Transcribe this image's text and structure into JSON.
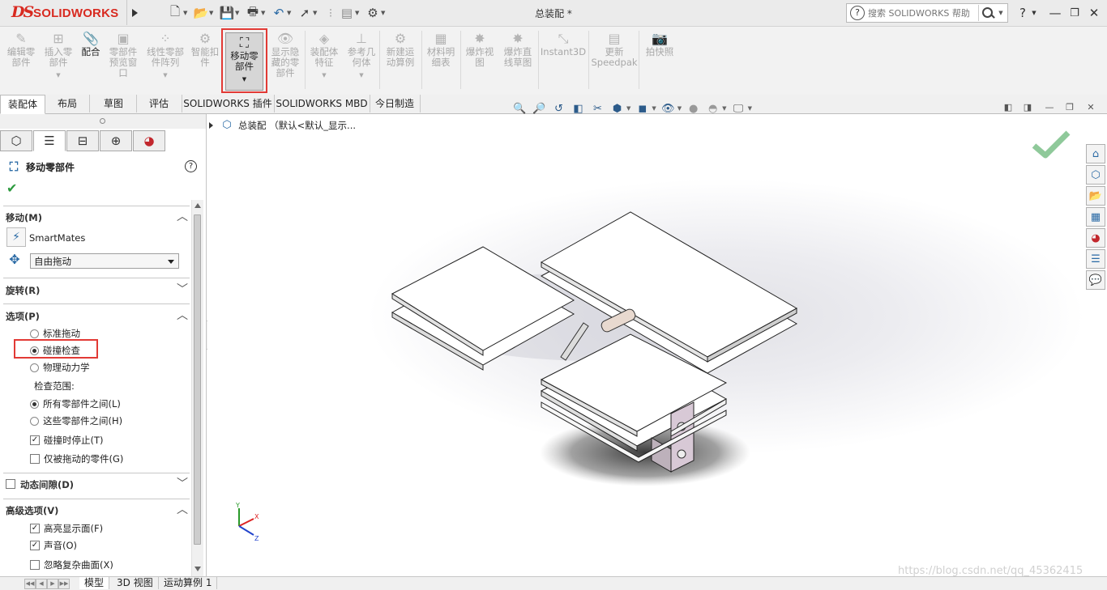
{
  "app": {
    "logo_ds": "DS",
    "logo_text": "SOLIDWORKS",
    "doc_title": "总装配 *",
    "search_placeholder": "搜索 SOLIDWORKS 帮助",
    "help_label": "?"
  },
  "ribbon": {
    "commands": [
      {
        "label": "编辑零\n部件",
        "icon": "edit-component-icon",
        "dropdown": false
      },
      {
        "label": "插入零\n部件",
        "icon": "insert-component-icon",
        "dropdown": true
      },
      {
        "label": "配合",
        "icon": "mate-icon",
        "dropdown": false
      },
      {
        "label": "零部件\n预览窗\n口",
        "icon": "preview-window-icon",
        "dropdown": false
      },
      {
        "label": "线性零部\n件阵列",
        "icon": "linear-pattern-icon",
        "dropdown": true
      },
      {
        "label": "智能扣\n件",
        "icon": "smart-fastener-icon",
        "dropdown": false
      },
      {
        "label": "移动零\n部件",
        "icon": "move-component-icon",
        "dropdown": true
      },
      {
        "label": "显示隐\n藏的零\n部件",
        "icon": "show-hidden-icon",
        "dropdown": false
      },
      {
        "label": "装配体\n特征",
        "icon": "assembly-feature-icon",
        "dropdown": true
      },
      {
        "label": "参考几\n何体",
        "icon": "reference-geometry-icon",
        "dropdown": true
      },
      {
        "label": "新建运\n动算例",
        "icon": "new-motion-study-icon",
        "dropdown": false
      },
      {
        "label": "材料明\n细表",
        "icon": "bom-icon",
        "dropdown": false
      },
      {
        "label": "爆炸视\n图",
        "icon": "exploded-view-icon",
        "dropdown": false
      },
      {
        "label": "爆炸直\n线草图",
        "icon": "explode-line-sketch-icon",
        "dropdown": false
      },
      {
        "label": "Instant3D",
        "icon": "instant3d-icon",
        "dropdown": false
      },
      {
        "label": "更新\nSpeedpak",
        "icon": "speedpak-icon",
        "dropdown": false
      },
      {
        "label": "拍快照",
        "icon": "snapshot-icon",
        "dropdown": false
      }
    ]
  },
  "tabs": [
    "装配体",
    "布局",
    "草图",
    "评估",
    "SOLIDWORKS 插件",
    "SOLIDWORKS MBD",
    "今日制造"
  ],
  "property_manager": {
    "title": "移动零部件",
    "sections": {
      "move": {
        "title": "移动(M)",
        "smartmates_label": "SmartMates",
        "drag_mode": "自由拖动"
      },
      "rotate": {
        "title": "旋转(R)"
      },
      "options": {
        "title": "选项(P)",
        "radios": [
          "标准拖动",
          "碰撞检查",
          "物理动力学"
        ],
        "selected_radio": "碰撞检查",
        "check_scope_label": "检查范围:",
        "scope_radios": [
          "所有零部件之间(L)",
          "这些零部件之间(H)"
        ],
        "selected_scope": "所有零部件之间(L)",
        "checkboxes": [
          {
            "label": "碰撞时停止(T)",
            "checked": true
          },
          {
            "label": "仅被拖动的零件(G)",
            "checked": false
          }
        ]
      },
      "dynamic_clearance": {
        "title": "动态间隙(D)",
        "checked": false
      },
      "advanced": {
        "title": "高级选项(V)",
        "checkboxes": [
          {
            "label": "高亮显示面(F)",
            "checked": true
          },
          {
            "label": "声音(O)",
            "checked": true
          },
          {
            "label": "忽略复杂曲面(X)",
            "checked": false
          }
        ]
      }
    }
  },
  "tree": {
    "root_label": "总装配 （默认<默认_显示..."
  },
  "bottom_tabs": [
    "模型",
    "3D 视图",
    "运动算例 1"
  ],
  "watermark": "https://blog.csdn.net/qq_45362415",
  "colors": {
    "accent_red": "#e23a35",
    "logo_red": "#d82a20",
    "ok_green": "#2c9a3e"
  }
}
